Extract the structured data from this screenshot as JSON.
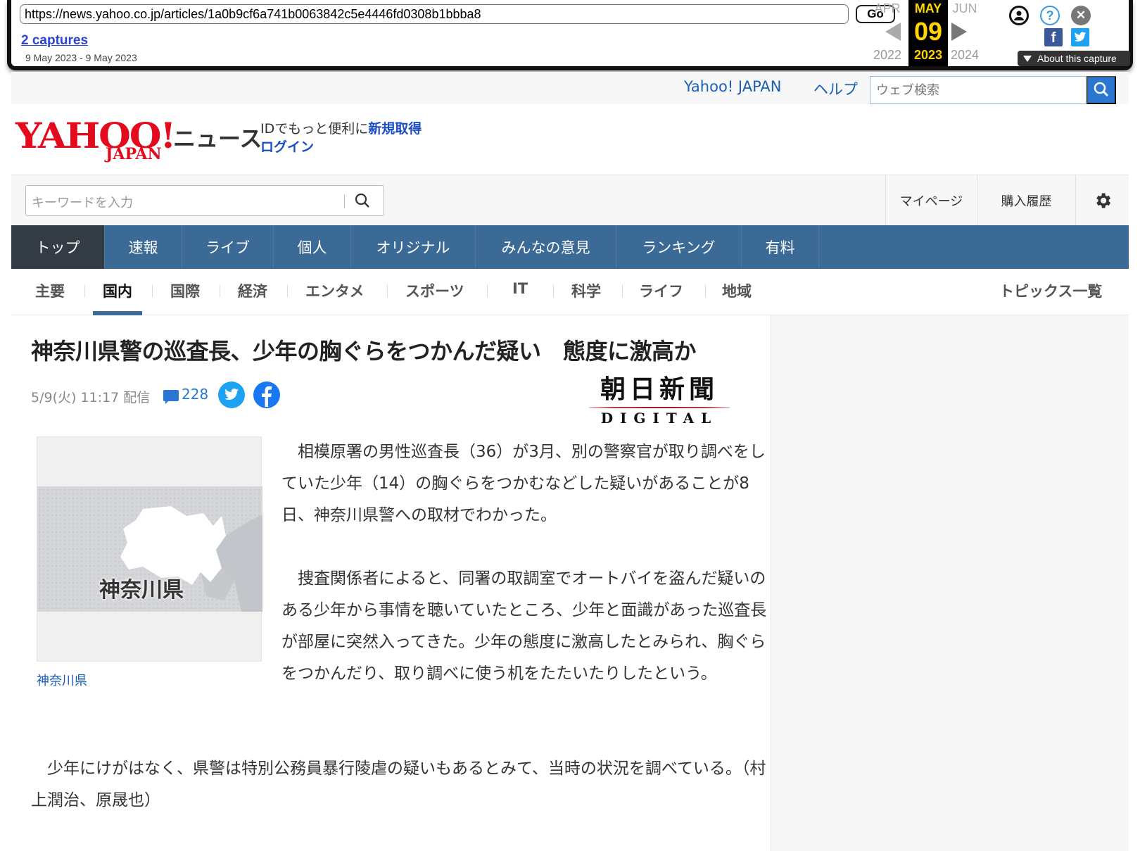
{
  "wayback": {
    "url": "https://news.yahoo.co.jp/articles/1a0b9cf6a741b0063842c5e4446fd0308b1bbba8",
    "go_label": "Go",
    "captures_link": "2 captures",
    "date_range": "9 May 2023 - 9 May 2023",
    "prev_month": "APR",
    "prev_year": "2022",
    "current_month": "MAY",
    "current_day": "09",
    "current_year": "2023",
    "next_month": "JUN",
    "next_year": "2024",
    "about_label": "About this capture",
    "icons": [
      "user-icon",
      "help-icon",
      "close-icon",
      "facebook-icon",
      "twitter-icon"
    ]
  },
  "header": {
    "yahoo_japan_link": "Yahoo! JAPAN",
    "help_link": "ヘルプ",
    "web_search_placeholder": "ウェブ検索",
    "logo_yahoo": "YAHOO!",
    "logo_japan": "JAPAN",
    "logo_news": "ニュース",
    "id_prompt": "IDでもっと便利に",
    "register_link": "新規取得",
    "login_link": "ログイン"
  },
  "searchrow": {
    "keyword_placeholder": "キーワードを入力",
    "mypage": "マイページ",
    "purchase_history": "購入履歴"
  },
  "main_nav": [
    "トップ",
    "速報",
    "ライブ",
    "個人",
    "オリジナル",
    "みんなの意見",
    "ランキング",
    "有料"
  ],
  "sub_nav": {
    "categories": [
      "主要",
      "国内",
      "国際",
      "経済",
      "エンタメ",
      "スポーツ",
      "IT",
      "科学",
      "ライフ",
      "地域"
    ],
    "active": "国内",
    "topics": "トピックス一覧"
  },
  "article": {
    "headline": "神奈川県警の巡査長、少年の胸ぐらをつかんだ疑い　態度に激高か",
    "date": "5/9(火) 11:17 配信",
    "comment_count": "228",
    "source_ja": "朝日新聞",
    "source_en": "DIGITAL",
    "image_label": "神奈川県",
    "caption": "神奈川県",
    "paragraphs": [
      "　相模原署の男性巡査長（36）が3月、別の警察官が取り調べをしていた少年（14）の胸ぐらをつかむなどした疑いがあることが8日、神奈川県警への取材でわかった。",
      "　捜査関係者によると、同署の取調室でオートバイを盗んだ疑いのある少年から事情を聴いていたところ、少年と面識があった巡査長が部屋に突然入ってきた。少年の態度に激高したとみられ、胸ぐらをつかんだり、取り調べに使う机をたたいたりしたという。",
      "　少年にけがはなく、県警は特別公務員暴行陵虐の疑いもあるとみて、当時の状況を調べている。（村上潤治、原晟也）"
    ]
  },
  "colors": {
    "nav_blue": "#3b6a96",
    "nav_active": "#333c44",
    "link_blue": "#1a5fb4",
    "yahoo_red": "#e30a1e"
  }
}
